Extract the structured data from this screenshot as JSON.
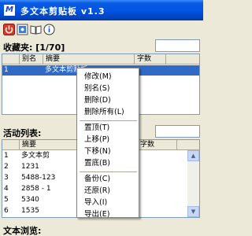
{
  "window": {
    "title": "多文本剪贴板 v1.3",
    "app_icon_text": "M"
  },
  "toolbar": {
    "icons": [
      "power-icon",
      "capture-icon",
      "book-icon",
      "info-icon"
    ]
  },
  "favorites": {
    "label": "收藏夹: [1/70]",
    "columns": [
      "",
      "别名",
      "摘要",
      "字数"
    ],
    "rows": [
      {
        "index": "1",
        "summary": "多文本剪贴板",
        "selected": true
      }
    ]
  },
  "activity": {
    "label": "活动列表:",
    "columns": [
      "",
      "摘要",
      "字数"
    ],
    "rows": [
      {
        "index": "1",
        "summary": "多文本剪"
      },
      {
        "index": "2",
        "summary": "1231"
      },
      {
        "index": "3",
        "summary": "5488-123"
      },
      {
        "index": "4",
        "summary": "2858 - 1"
      },
      {
        "index": "5",
        "summary": "5340"
      },
      {
        "index": "6",
        "summary": "1535"
      }
    ]
  },
  "preview": {
    "label": "文本浏览:"
  },
  "context_menu": {
    "groups": [
      [
        "修改(M)",
        "别名(S)",
        "删除(D)",
        "删除所有(L)"
      ],
      [
        "置顶(T)",
        "上移(P)",
        "下移(N)",
        "置底(B)"
      ],
      [
        "备份(C)",
        "还原(R)",
        "导入(I)",
        "导出(E)"
      ]
    ]
  },
  "colors": {
    "title_bar": "#0055e5",
    "selection": "#316ac5",
    "background": "#ece9d8"
  }
}
